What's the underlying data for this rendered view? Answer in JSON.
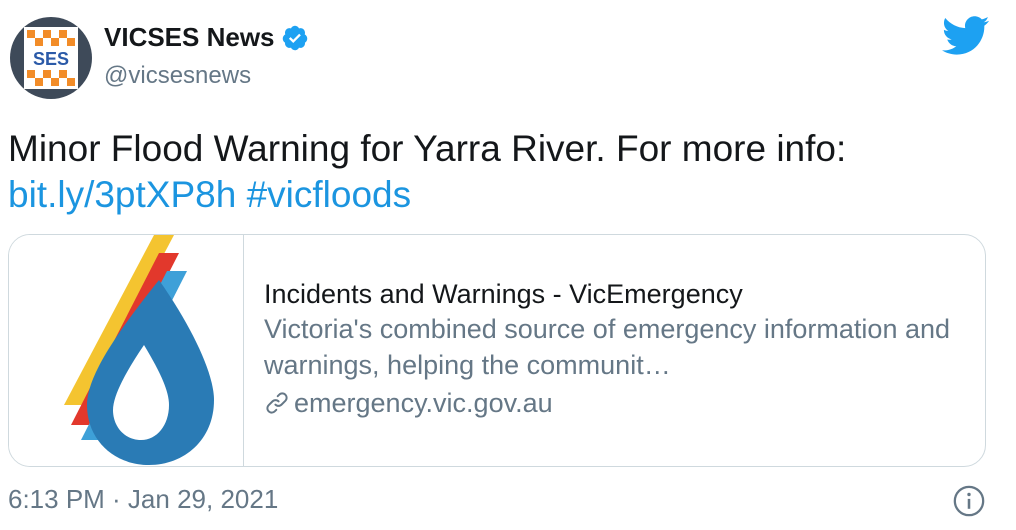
{
  "author": {
    "display_name": "VICSES News",
    "handle": "@vicsesnews",
    "avatar_text": "SES",
    "verified": true
  },
  "tweet": {
    "text": "Minor Flood Warning for Yarra River. For more info:",
    "link": "bit.ly/3ptXP8h",
    "hashtag": "#vicfloods"
  },
  "card": {
    "title": "Incidents and Warnings - VicEmergency",
    "description": "Victoria's combined source of emergency information and warnings, helping the communit…",
    "domain": "emergency.vic.gov.au"
  },
  "timestamp": "6:13 PM · Jan 29, 2021",
  "icons": {
    "verified": "verified-badge-icon",
    "bird": "twitter-bird-icon",
    "link": "link-icon",
    "info": "info-icon"
  },
  "colors": {
    "link": "#1b95e0",
    "secondary_text": "#657786",
    "border": "#cfd9de",
    "twitter_blue": "#1da1f2"
  }
}
